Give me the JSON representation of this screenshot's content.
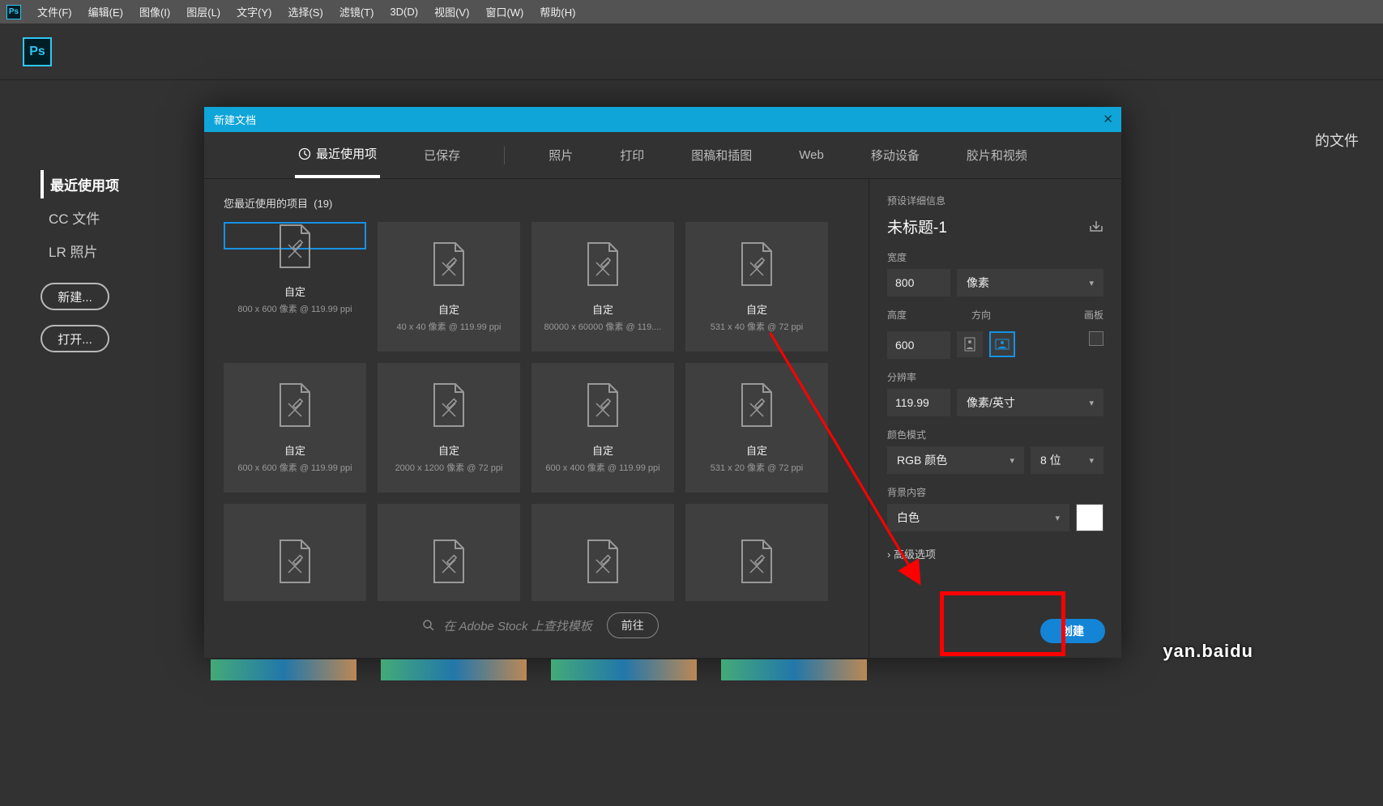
{
  "menu": [
    "文件(F)",
    "编辑(E)",
    "图像(I)",
    "图层(L)",
    "文字(Y)",
    "选择(S)",
    "滤镜(T)",
    "3D(D)",
    "视图(V)",
    "窗口(W)",
    "帮助(H)"
  ],
  "start": {
    "nav": [
      "最近使用项",
      "CC 文件",
      "LR 照片"
    ],
    "newBtn": "新建...",
    "openBtn": "打开...",
    "behind": "的文件"
  },
  "dialog": {
    "title": "新建文档",
    "tabs": [
      "最近使用项",
      "已保存",
      "照片",
      "打印",
      "图稿和插图",
      "Web",
      "移动设备",
      "胶片和视频"
    ],
    "recentHeader": "您最近使用的项目",
    "recentCount": "(19)",
    "cards": [
      {
        "name": "自定",
        "meta": "800 x 600 像素 @ 119.99 ppi",
        "sel": true
      },
      {
        "name": "自定",
        "meta": "40 x 40 像素 @ 119.99 ppi"
      },
      {
        "name": "自定",
        "meta": "80000 x 60000 像素 @ 119...."
      },
      {
        "name": "自定",
        "meta": "531 x 40 像素 @ 72 ppi"
      },
      {
        "name": "自定",
        "meta": "600 x 600 像素 @ 119.99 ppi"
      },
      {
        "name": "自定",
        "meta": "2000 x 1200 像素 @ 72 ppi"
      },
      {
        "name": "自定",
        "meta": "600 x 400 像素 @ 119.99 ppi"
      },
      {
        "name": "自定",
        "meta": "531 x 20 像素 @ 72 ppi"
      },
      {
        "name": "",
        "meta": ""
      },
      {
        "name": "",
        "meta": ""
      },
      {
        "name": "",
        "meta": ""
      },
      {
        "name": "",
        "meta": ""
      }
    ],
    "stock": {
      "placeholder": "在 Adobe Stock 上查找模板",
      "go": "前往"
    },
    "details": {
      "header": "预设详细信息",
      "docTitle": "未标题-1",
      "widthLabel": "宽度",
      "widthVal": "800",
      "widthUnit": "像素",
      "heightLabel": "高度",
      "heightVal": "600",
      "orientLabel": "方向",
      "artboardLabel": "画板",
      "resLabel": "分辨率",
      "resVal": "119.99",
      "resUnit": "像素/英寸",
      "modeLabel": "颜色模式",
      "modeVal": "RGB 颜色",
      "bits": "8 位",
      "bgLabel": "背景内容",
      "bgVal": "白色",
      "adv": "高级选项",
      "create": "创建"
    }
  },
  "watermark": "yan.baidu"
}
